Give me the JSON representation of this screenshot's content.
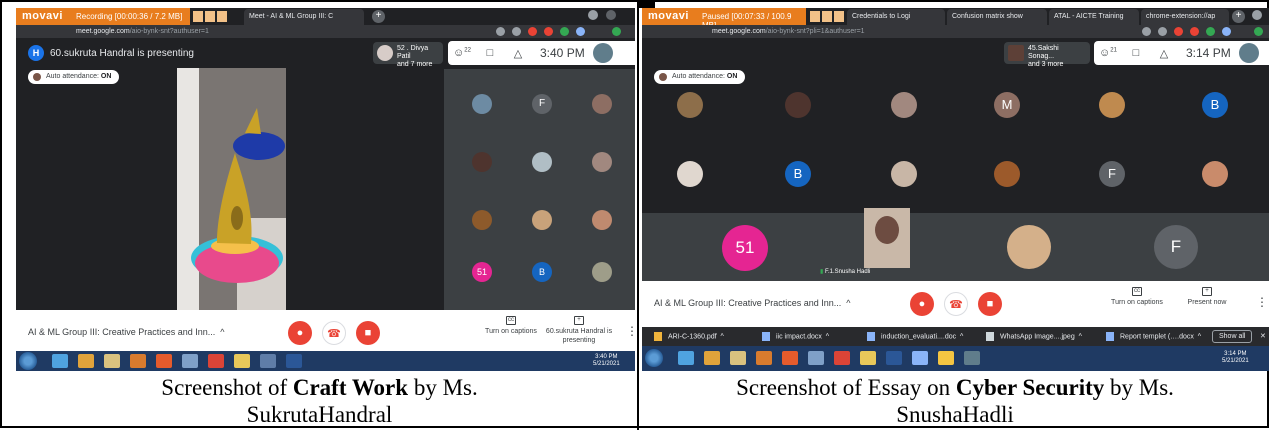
{
  "left_screenshot": {
    "recorder": {
      "logo": "movavi",
      "status": "Recording  [00:00:36 / 7.2 MB]"
    },
    "tabs": [
      {
        "label": "Meet - AI & ML Group III: C"
      }
    ],
    "url": {
      "host": "meet.google.com",
      "path": "/aio-bynk-snt?authuser=1"
    },
    "presenter": {
      "initial": "H",
      "text": "60.sukruta Handral is presenting"
    },
    "participants_panel": {
      "line1": "52 . Divya Patil",
      "line2": "and 7 more"
    },
    "toolbar": {
      "people_count": "22",
      "time": "3:40 PM",
      "you_label": "You"
    },
    "attendance": {
      "label": "Auto attendance:",
      "value": "ON"
    },
    "grid_tiles": [
      "F",
      "51",
      "B"
    ],
    "meeting_title": "AI & ML Group III: Creative Practices and Inn...",
    "captions_label": "Turn on captions",
    "presenting_label": "60.sukruta Handral is presenting",
    "clock": {
      "time": "3:40 PM",
      "date": "5/21/2021"
    }
  },
  "right_screenshot": {
    "recorder": {
      "logo": "movavi",
      "status": "Paused  [00:07:33 / 100.9 MB]"
    },
    "tabs": [
      {
        "label": "Credentials to Logi"
      },
      {
        "label": "Confusion matrix show"
      },
      {
        "label": "ATAL - AICTE Training"
      },
      {
        "label": "chrome-extension://ap"
      }
    ],
    "url": {
      "host": "meet.google.com",
      "path": "/aio-bynk-snt?pli=1&authuser=1"
    },
    "participants_panel": {
      "line1": "45.Sakshi Sonag...",
      "line2": "and 3 more"
    },
    "toolbar": {
      "people_count": "21",
      "time": "3:14 PM",
      "you_label": "You"
    },
    "attendance": {
      "label": "Auto attendance:",
      "value": "ON"
    },
    "grid_tiles": [
      "M",
      "B",
      "B",
      "F",
      "51",
      "F"
    ],
    "speaker_name": "F.1.Snusha Hadli",
    "meeting_title": "AI & ML Group III: Creative Practices and Inn...",
    "captions_label": "Turn on captions",
    "present_label": "Present now",
    "downloads": [
      "ARI-C-1360.pdf",
      "iic impact.docx",
      "induction_evaluati....doc",
      "WhatsApp Image....jpeg",
      "Report templet (….docx"
    ],
    "show_all": "Show all",
    "clock": {
      "time": "3:14 PM",
      "date": "5/21/2021"
    }
  },
  "captions": {
    "left": {
      "prefix": "Screenshot of ",
      "bold": "Craft Work",
      "suffix": " by Ms.",
      "line2": "SukrutaHandral"
    },
    "right": {
      "prefix": "Screenshot of Essay on ",
      "bold": "Cyber Security",
      "suffix": " by Ms.",
      "line2": "SnushaHadli"
    }
  },
  "colors": {
    "meet_bg": "#202124",
    "recorder_orange": "#e87d1e",
    "end_call_red": "#ea4335",
    "avatar_pink": "#e52592",
    "avatar_blue": "#1565c0",
    "avatar_grey": "#5f6368",
    "avatar_brown": "#8d6e63"
  }
}
